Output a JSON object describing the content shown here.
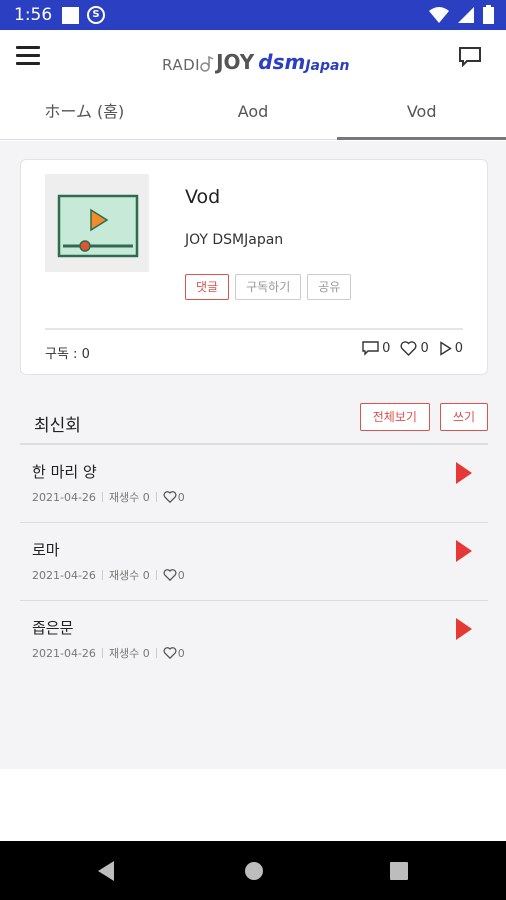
{
  "status_bar": {
    "time": "1:56",
    "sync_glyph": "S"
  },
  "app_bar": {
    "logo_radio": "RADI",
    "logo_joy": "JOY",
    "logo_dsm": "dsm",
    "logo_japan": "Japan"
  },
  "tabs": [
    {
      "label": "ホーム (홈)"
    },
    {
      "label": "Aod"
    },
    {
      "label": "Vod"
    }
  ],
  "card": {
    "title": "Vod",
    "channel": "JOY DSMJapan",
    "buttons": {
      "comment": "댓글",
      "subscribe": "구독하기",
      "share": "공유"
    },
    "subscribers": "구독 : 0",
    "stats": {
      "comments": "0",
      "likes": "0",
      "plays": "0"
    }
  },
  "section": {
    "title": "최신회",
    "view_all": "전체보기",
    "write": "쓰기"
  },
  "episodes": [
    {
      "title": "한 마리 양",
      "date": "2021-04-26",
      "plays": "재생수 0",
      "likes": "0"
    },
    {
      "title": "로마",
      "date": "2021-04-26",
      "plays": "재생수 0",
      "likes": "0"
    },
    {
      "title": "좁은문",
      "date": "2021-04-26",
      "plays": "재생수 0",
      "likes": "0"
    }
  ],
  "colors": {
    "status_bar": "#2b3fc2",
    "accent_red": "#d9534f",
    "play_red": "#e53935"
  }
}
